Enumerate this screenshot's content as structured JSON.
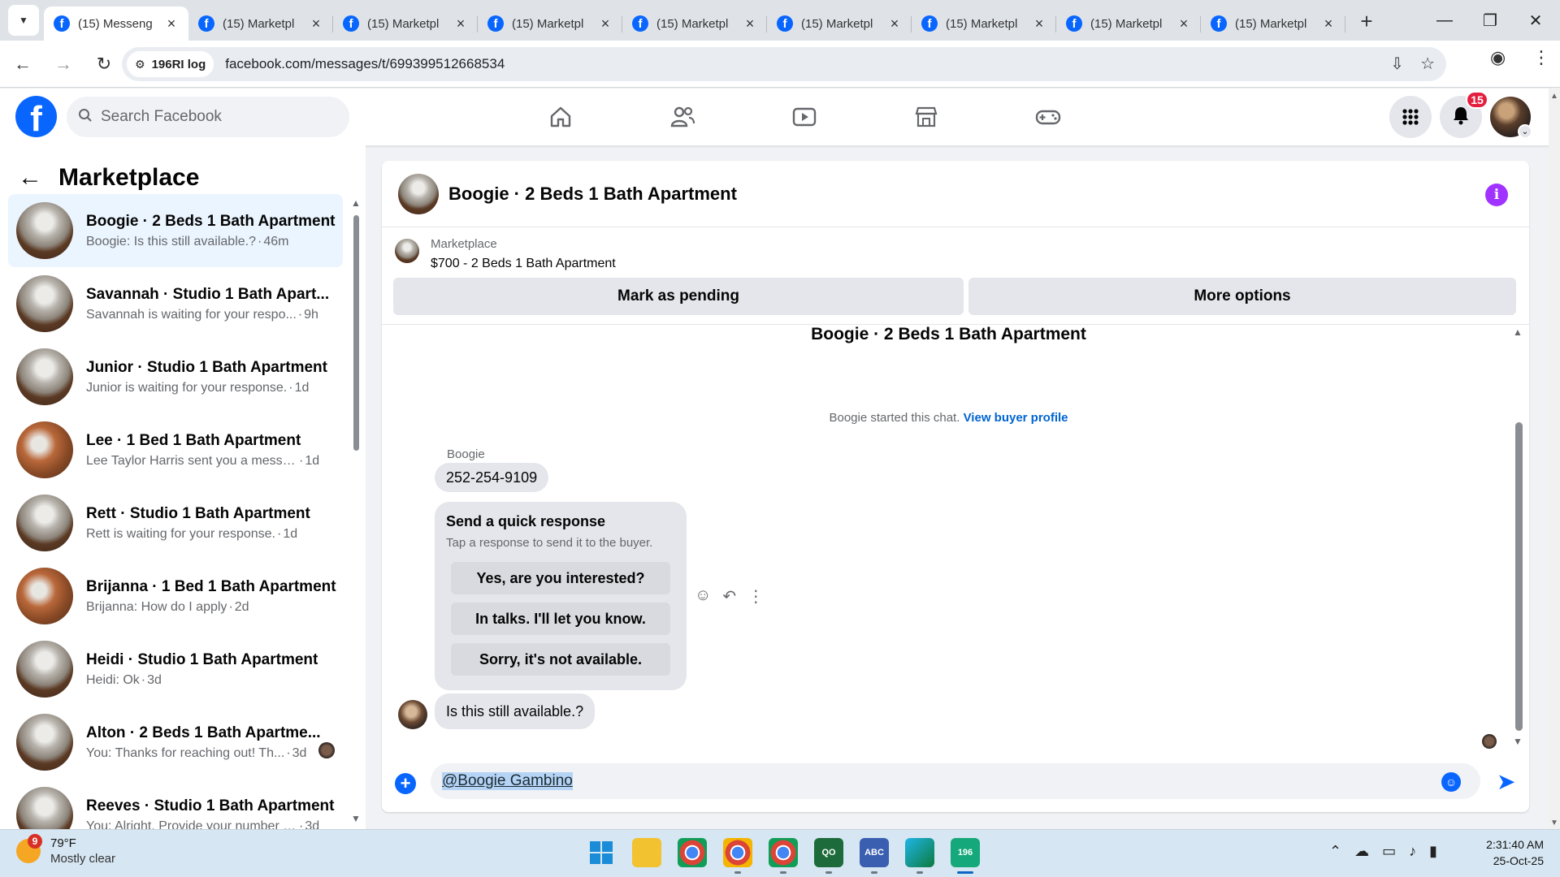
{
  "browser": {
    "tabs": [
      {
        "title": "(15) Messeng",
        "active": true
      },
      {
        "title": "(15) Marketpl"
      },
      {
        "title": "(15) Marketpl"
      },
      {
        "title": "(15) Marketpl"
      },
      {
        "title": "(15) Marketpl"
      },
      {
        "title": "(15) Marketpl"
      },
      {
        "title": "(15) Marketpl"
      },
      {
        "title": "(15) Marketpl"
      },
      {
        "title": "(15) Marketpl"
      }
    ],
    "site_chip": "196RI log",
    "url": "facebook.com/messages/t/699399512668534"
  },
  "fb": {
    "logo": "f",
    "search_placeholder": "Search Facebook",
    "notifications_count": "15"
  },
  "sidebar": {
    "title": "Marketplace",
    "conversations": [
      {
        "name": "Boogie · 2 Beds 1 Bath Apartment",
        "snippet": "Boogie: Is this still available.?",
        "time": "46m",
        "thumb": "room",
        "selected": true
      },
      {
        "name": "Savannah · Studio 1 Bath Apart...",
        "snippet": "Savannah is waiting for your respo...",
        "time": "9h",
        "thumb": "room"
      },
      {
        "name": "Junior · Studio 1 Bath Apartment",
        "snippet": "Junior is waiting for your response.",
        "time": "1d",
        "thumb": "room"
      },
      {
        "name": "Lee · 1 Bed 1 Bath Apartment",
        "snippet": "Lee Taylor Harris sent you a messa...",
        "time": "1d",
        "thumb": "kitchen"
      },
      {
        "name": "Rett · Studio 1 Bath Apartment",
        "snippet": "Rett is waiting for your response.",
        "time": "1d",
        "thumb": "room"
      },
      {
        "name": "Brijanna · 1 Bed 1 Bath Apartment",
        "snippet": "Brijanna: How do I apply",
        "time": "2d",
        "thumb": "kitchen"
      },
      {
        "name": "Heidi · Studio 1 Bath Apartment",
        "snippet": "Heidi: Ok",
        "time": "3d",
        "thumb": "room"
      },
      {
        "name": "Alton · 2 Beds 1 Bath Apartme...",
        "snippet": "You: Thanks for reaching out! Th...",
        "time": "3d",
        "thumb": "room",
        "seen": true
      },
      {
        "name": "Reeves · Studio 1 Bath Apartment",
        "snippet": "You: Alright. Provide your number I'...",
        "time": "3d",
        "thumb": "room"
      }
    ]
  },
  "chat": {
    "title": "Boogie · 2 Beds 1 Bath Apartment",
    "listing_category": "Marketplace",
    "listing_price": "$700 - 2 Beds 1 Bath Apartment",
    "mark_pending_label": "Mark as pending",
    "more_options_label": "More options",
    "thread_title": "Boogie · 2 Beds 1 Bath Apartment",
    "started_text": "Boogie started this chat.",
    "view_profile_label": "View buyer profile",
    "sender_name": "Boogie",
    "msg_phone": "252-254-9109",
    "quick_title": "Send a quick response",
    "quick_sub": "Tap a response to send it to the buyer.",
    "quick_replies": [
      "Yes, are you interested?",
      "In talks. I'll let you know.",
      "Sorry, it's not available."
    ],
    "last_msg": "Is this still available.?",
    "composer_value": "@Boogie Gambino"
  },
  "taskbar": {
    "weather_badge": "9",
    "temp": "79°F",
    "condition": "Mostly clear",
    "time": "2:31:40 AM",
    "date": "25-Oct-25"
  },
  "colors": {
    "fb_blue": "#0866ff",
    "selected_row": "#ebf5ff",
    "info_purple": "#a033ff",
    "badge_red": "#e41e3f",
    "link_blue": "#0064d1"
  },
  "icons": [
    "tab-search-icon",
    "facebook-favicon-icon",
    "close-tab-icon",
    "new-tab-icon",
    "minimize-icon",
    "restore-icon",
    "window-close-icon",
    "back-icon",
    "forward-icon",
    "reload-icon",
    "site-info-icon",
    "install-app-icon",
    "bookmark-star-icon",
    "profile-icon",
    "browser-menu-icon",
    "search-icon",
    "home-icon",
    "friends-icon",
    "video-icon",
    "marketplace-icon",
    "gaming-icon",
    "menu-grid-icon",
    "bell-icon",
    "info-icon",
    "emoji-react-icon",
    "reply-icon",
    "more-icon",
    "plus-icon",
    "emoji-icon",
    "send-icon"
  ]
}
